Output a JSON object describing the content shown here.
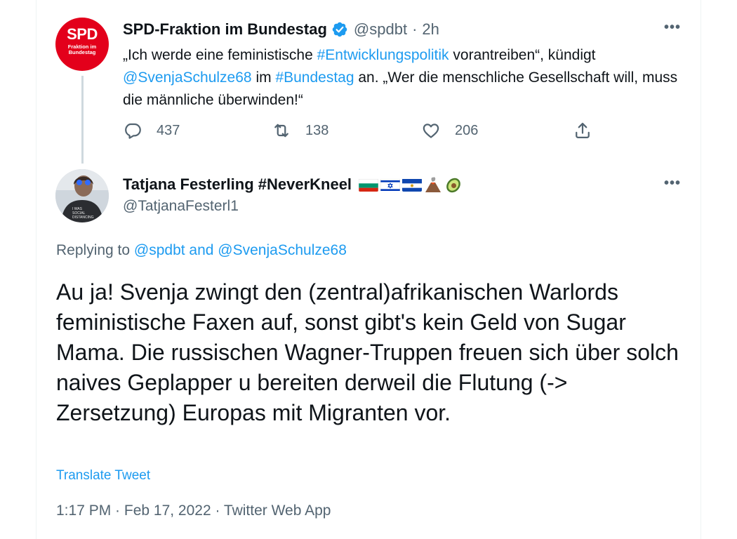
{
  "parent_tweet": {
    "avatar": {
      "line1": "SPD",
      "line2": "Fraktion im",
      "line3": "Bundestag"
    },
    "author_name": "SPD-Fraktion im Bundestag",
    "handle": "@spdbt",
    "separator": "·",
    "time": "2h",
    "more_icon": "ellipsis-icon",
    "text_parts": {
      "p1": "„Ich werde eine feministische ",
      "h1": "#Entwicklungspolitik",
      "p2": " vorantreiben“, kündigt ",
      "m1": "@SvenjaSchulze68",
      "p3": " im ",
      "h2": "#Bundestag",
      "p4": " an. „Wer die menschliche Gesellschaft will, muss die männliche überwinden!“"
    },
    "actions": {
      "reply_count": "437",
      "retweet_count": "138",
      "like_count": "206"
    }
  },
  "reply_tweet": {
    "author_name": "Tatjana Festerling #NeverKneel",
    "handle": "@TatjanaFesterl1",
    "flags": [
      "bulgaria-flag",
      "israel-flag",
      "el-salvador-flag",
      "volcano-emoji",
      "avocado-emoji"
    ],
    "replying_to_label": "Replying to",
    "replying_to_users": "@spdbt and @SvenjaSchulze68",
    "text": "Au ja! Svenja zwingt den (zentral)afrikanischen Warlords feministische Faxen auf, sonst gibt's kein Geld von Sugar Mama. Die russischen Wagner-Truppen freuen sich über solch naives Geplapper u bereiten derweil die Flutung (-> Zersetzung) Europas mit Migranten vor.",
    "translate_label": "Translate Tweet",
    "meta": "1:17 PM · Feb 17, 2022 · Twitter Web App"
  },
  "colors": {
    "accent": "#1d9bf0",
    "secondary_text": "#536471",
    "spd_red": "#e3001b"
  }
}
